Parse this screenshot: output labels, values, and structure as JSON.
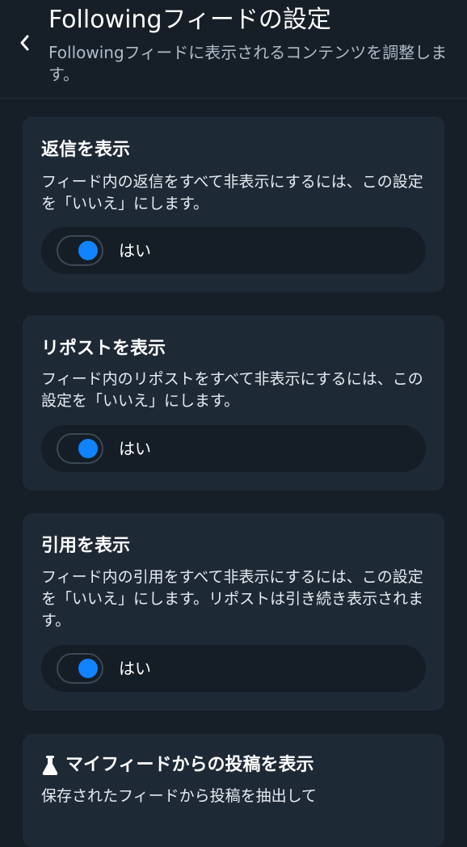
{
  "header": {
    "title": "Followingフィードの設定",
    "subtitle": "Followingフィードに表示されるコンテンツを調整します。",
    "back_icon": "chevron-left-icon"
  },
  "colors": {
    "background": "#161e27",
    "card": "#1e2936",
    "toggle_row": "#151d26",
    "accent": "#1083fe",
    "subtitle": "#aebbc9"
  },
  "cards": [
    {
      "title": "返信を表示",
      "description": "フィード内の返信をすべて非表示にするには、この設定を「いいえ」にします。",
      "toggle": {
        "label": "はい",
        "on": true
      }
    },
    {
      "title": "リポストを表示",
      "description": "フィード内のリポストをすべて非表示にするには、この設定を「いいえ」にします。",
      "toggle": {
        "label": "はい",
        "on": true
      }
    },
    {
      "title": "引用を表示",
      "description": "フィード内の引用をすべて非表示にするには、この設定を「いいえ」にします。リポストは引き続き表示されます。",
      "toggle": {
        "label": "はい",
        "on": true
      }
    },
    {
      "title": "マイフィードからの投稿を表示",
      "title_icon": "flask-icon",
      "description": "保存されたフィードから投稿を抽出して"
    }
  ]
}
